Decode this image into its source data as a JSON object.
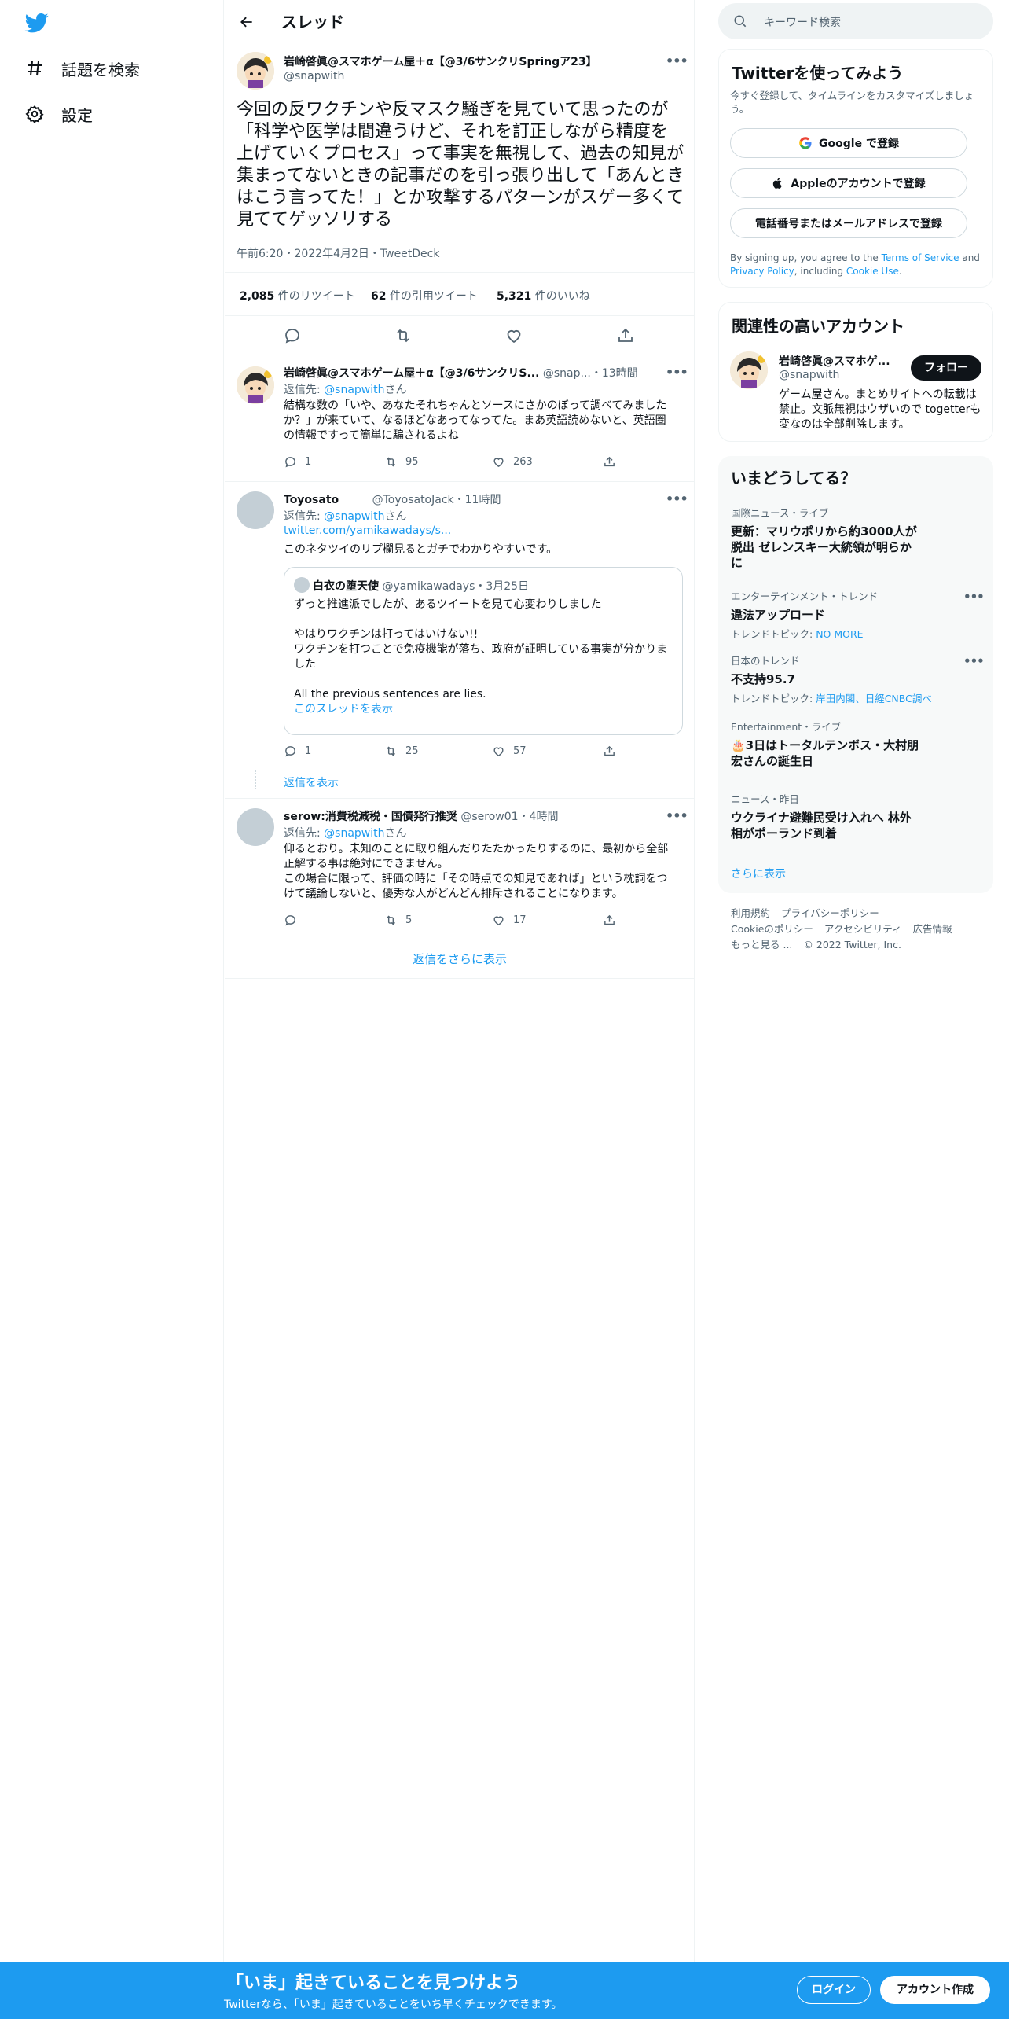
{
  "colors": {
    "accent": "#1d9bf0",
    "text": "#0f1419",
    "muted": "#536471",
    "border": "#eff3f4"
  },
  "nav": {
    "logo_icon": "twitter-bird-icon",
    "explore": "話題を検索",
    "settings": "設定"
  },
  "header": {
    "title": "スレッド"
  },
  "focal": {
    "name": "岩崎啓眞@スマホゲーム屋＋α【@3/6サンクリSpringア23】",
    "handle": "@snapwith",
    "text": "今回の反ワクチンや反マスク騒ぎを見ていて思ったのが「科学や医学は間違うけど、それを訂正しながら精度を上げていくプロセス」って事実を無視して、過去の知見が集まってないときの記事だのを引っ張り出して「あんときはこう言ってた！」とか攻撃するパターンがスゲー多くて見ててゲッソリする",
    "meta": "午前6:20・2022年4月2日・TweetDeck",
    "retweets_n": "2,085",
    "retweets_label": "件のリツイート",
    "quotes_n": "62",
    "quotes_label": "件の引用ツイート",
    "likes_n": "5,321",
    "likes_label": "件のいいね"
  },
  "replies": [
    {
      "name": "岩崎啓眞@スマホゲーム屋＋α【@3/6サンクリS...",
      "handle": "@snap...",
      "time": "・13時間",
      "reply_prefix": "返信先: ",
      "reply_to": "@snapwith",
      "reply_suffix": "さん",
      "text": "結構な数の「いや、あなたそれちゃんとソースにさかのぼって調べてみましたか？」が来ていて、なるほどなあってなってた。まあ英語読めないと、英語圏の情報ですって簡単に騙されるよね",
      "replies": "1",
      "retweets": "95",
      "likes": "263"
    },
    {
      "name": "Toyosato",
      "handle": "@ToyosatoJack",
      "time": "・11時間",
      "reply_prefix": "返信先: ",
      "reply_to": "@snapwith",
      "reply_suffix": "さん",
      "link": "twitter.com/yamikawadays/s...",
      "text": "このネタツイのリプ欄見るとガチでわかりやすいです。",
      "quote": {
        "name": "白衣の堕天使",
        "handle": "@yamikawadays",
        "time": "・3月25日",
        "line1": "ずっと推進派でしたが、あるツイートを見て心変わりしました",
        "line2": "やはりワクチンは打ってはいけない!!",
        "line3": "ワクチンを打つことで免疫機能が落ち、政府が証明している事実が分かりました",
        "line4": "All the previous sentences are lies.",
        "show_thread": "このスレッドを表示"
      },
      "replies": "1",
      "retweets": "25",
      "likes": "57",
      "show_replies": "返信を表示"
    },
    {
      "name": "serow:消費税減税・国債発行推奨",
      "handle": "@serow01",
      "time": "・4時間",
      "reply_prefix": "返信先: ",
      "reply_to": "@snapwith",
      "reply_suffix": "さん",
      "text1": "仰るとおり。未知のことに取り組んだりたたかったりするのに、最初から全部正解する事は絶対にできません。",
      "text2": "この場合に限って、評価の時に「その時点での知見であれば」という枕詞をつけて議論しないと、優秀な人がどんどん排斥されることになります。",
      "replies": "",
      "retweets": "5",
      "likes": "17"
    }
  ],
  "more_replies": "返信をさらに表示",
  "right": {
    "search_placeholder": "キーワード検索",
    "signup": {
      "title": "Twitterを使ってみよう",
      "subtitle": "今すぐ登録して、タイムラインをカスタマイズしましょう。",
      "google": "Google で登録",
      "apple": "Appleのアカウントで登録",
      "phone": "電話番号またはメールアドレスで登録",
      "terms_1": "By signing up, you agree to the ",
      "terms_tos": "Terms of Service",
      "terms_2": " and ",
      "terms_privacy": "Privacy Policy",
      "terms_3": ", including ",
      "terms_cookie": "Cookie Use",
      "terms_4": "."
    },
    "related": {
      "title": "関連性の高いアカウント",
      "name": "岩崎啓眞@スマホゲ...",
      "handle": "@snapwith",
      "follow": "フォロー",
      "bio": "ゲーム屋さん。まとめサイトへの転載は禁止。文脈無視はウザいので togetterも変なのは全部削除します。"
    },
    "trends": {
      "title": "いまどうしてる？",
      "items": [
        {
          "cat": "国際ニュース・ライブ",
          "title": "更新：マリウポリから約3000人が脱出 ゼレンスキー大統領が明らかに",
          "sub_label": "",
          "sub_link": ""
        },
        {
          "cat": "エンターテインメント・トレンド",
          "title": "違法アップロード",
          "sub_label": "トレンドトピック: ",
          "sub_link": "NO MORE"
        },
        {
          "cat": "日本のトレンド",
          "title": "不支持95.7",
          "sub_label": "トレンドトピック: ",
          "sub_link": "岸田内閣、日経CNBC調べ"
        },
        {
          "cat": "Entertainment・ライブ",
          "title": "🎂3日はトータルテンボス・大村朋宏さんの誕生日",
          "sub_label": "",
          "sub_link": ""
        },
        {
          "cat": "ニュース・昨日",
          "title": "ウクライナ避難民受け入れへ 林外相がポーランド到着",
          "sub_label": "",
          "sub_link": ""
        }
      ],
      "show_more": "さらに表示"
    },
    "footer": {
      "terms": "利用規約",
      "privacy": "プライバシーポリシー",
      "cookie": "Cookieのポリシー",
      "accessibility": "アクセシビリティ",
      "ads": "広告情報",
      "more": "もっと見る ...",
      "copyright": "© 2022 Twitter, Inc."
    }
  },
  "bottom": {
    "headline": "「いま」起きていることを見つけよう",
    "sub": "Twitterなら、「いま」起きていることをいち早くチェックできます。",
    "login": "ログイン",
    "signup": "アカウント作成"
  }
}
